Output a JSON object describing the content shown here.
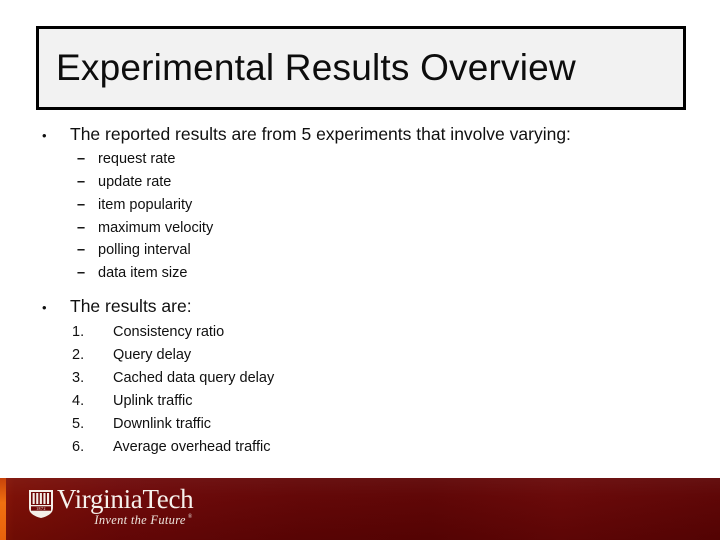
{
  "slide": {
    "title": "Experimental Results Overview",
    "title_box": {
      "fill": "#f2f2f2",
      "border": "#000000"
    },
    "background": "#ffffff"
  },
  "body": {
    "bullets": [
      {
        "marker": "•",
        "text": "The reported results are from 5 experiments that involve varying:",
        "subitems": [
          {
            "marker": "–",
            "text": "request rate"
          },
          {
            "marker": "–",
            "text": "update rate"
          },
          {
            "marker": "–",
            "text": "item popularity"
          },
          {
            "marker": "–",
            "text": "maximum velocity"
          },
          {
            "marker": "–",
            "text": "polling interval"
          },
          {
            "marker": "–",
            "text": "data item size"
          }
        ]
      },
      {
        "marker": "•",
        "text": "The results are:",
        "numbered": [
          {
            "marker": "1.",
            "text": "Consistency ratio"
          },
          {
            "marker": "2.",
            "text": "Query delay"
          },
          {
            "marker": "3.",
            "text": "Cached data query delay"
          },
          {
            "marker": "4.",
            "text": "Uplink traffic"
          },
          {
            "marker": "5.",
            "text": "Downlink traffic"
          },
          {
            "marker": "6.",
            "text": "Average overhead traffic"
          }
        ]
      }
    ]
  },
  "footer": {
    "logo_name": "VirginiaTech",
    "tagline": "Invent the Future",
    "registered_mark": "®",
    "emblem_year": "1872",
    "band_color": "#610404",
    "accent_color": "#ef6f10",
    "text_color": "#f6f1ec"
  }
}
